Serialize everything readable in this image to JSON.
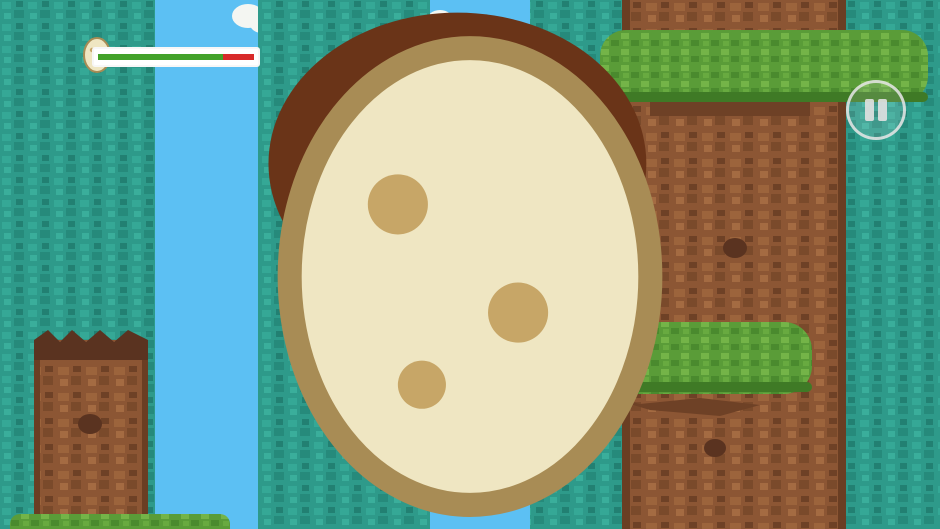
{
  "hud": {
    "health_fraction": 0.8,
    "health_color": "#43a22a",
    "damage_color": "#d82a2a",
    "portrait_icon": "caveman-face-icon",
    "lives_icon": "egg-icon",
    "pause_icon": "pause-icon"
  },
  "world": {
    "sky_color": "#5cc0f3",
    "foliage_color": "#2f9c8c",
    "bark_color": "#8a5432",
    "leaf_color": "#5fa03a",
    "collectible_icon": "egg-icon",
    "player_sprite": "caveman-player"
  }
}
